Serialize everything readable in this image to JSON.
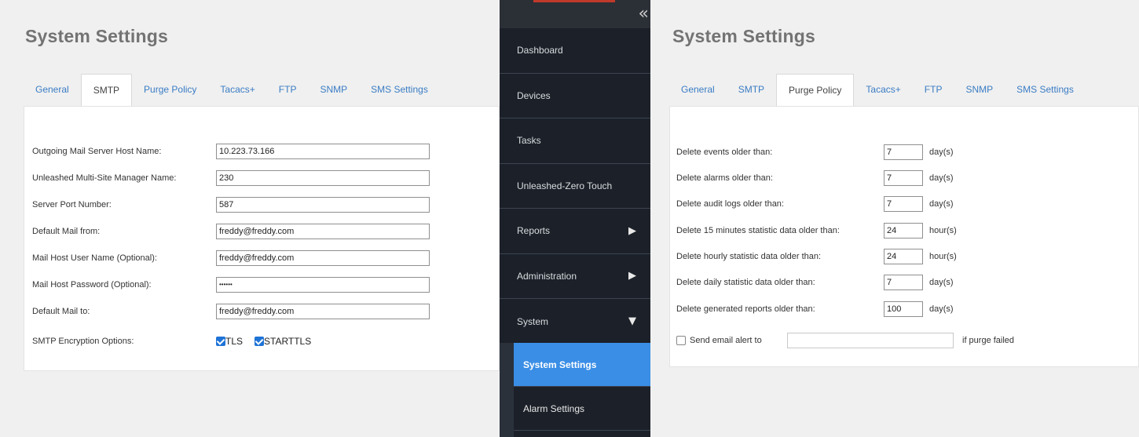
{
  "left_panel": {
    "title": "System Settings",
    "tabs": [
      {
        "label": "General"
      },
      {
        "label": "SMTP"
      },
      {
        "label": "Purge Policy"
      },
      {
        "label": "Tacacs+"
      },
      {
        "label": "FTP"
      },
      {
        "label": "SNMP"
      },
      {
        "label": "SMS Settings"
      }
    ],
    "active_tab": "SMTP",
    "fields": [
      {
        "label": "Outgoing Mail Server Host Name:",
        "value": "10.223.73.166"
      },
      {
        "label": "Unleashed Multi-Site Manager Name:",
        "value": "230"
      },
      {
        "label": "Server Port Number:",
        "value": "587"
      },
      {
        "label": "Default Mail from:",
        "value": "freddy@freddy.com"
      },
      {
        "label": "Mail Host User Name (Optional):",
        "value": "freddy@freddy.com"
      },
      {
        "label": "Mail Host Password (Optional):",
        "value": "••••••"
      },
      {
        "label": "Default Mail to:",
        "value": "freddy@freddy.com"
      }
    ],
    "encryption": {
      "label": "SMTP Encryption Options:",
      "options": [
        {
          "label": "TLS",
          "checked": true
        },
        {
          "label": "STARTTLS",
          "checked": true
        }
      ]
    }
  },
  "sidebar": {
    "items": [
      {
        "label": "Dashboard",
        "arrow": ""
      },
      {
        "label": "Devices",
        "arrow": ""
      },
      {
        "label": "Tasks",
        "arrow": ""
      },
      {
        "label": "Unleashed-Zero Touch",
        "arrow": ""
      },
      {
        "label": "Reports",
        "arrow": "▶"
      },
      {
        "label": "Administration",
        "arrow": "▶"
      },
      {
        "label": "System",
        "arrow": "▼"
      }
    ],
    "subitems": [
      {
        "label": "System Settings",
        "active": true
      },
      {
        "label": "Alarm Settings",
        "active": false
      }
    ],
    "collapse_glyph": "«"
  },
  "right_panel": {
    "title": "System Settings",
    "tabs": [
      {
        "label": "General"
      },
      {
        "label": "SMTP"
      },
      {
        "label": "Purge Policy"
      },
      {
        "label": "Tacacs+"
      },
      {
        "label": "FTP"
      },
      {
        "label": "SNMP"
      },
      {
        "label": "SMS Settings"
      }
    ],
    "active_tab": "Purge Policy",
    "rows": [
      {
        "label": "Delete events older than:",
        "value": "7",
        "unit": "day(s)"
      },
      {
        "label": "Delete alarms older than:",
        "value": "7",
        "unit": "day(s)"
      },
      {
        "label": "Delete audit logs older than:",
        "value": "7",
        "unit": "day(s)"
      },
      {
        "label": "Delete 15 minutes statistic data older than:",
        "value": "24",
        "unit": "hour(s)"
      },
      {
        "label": "Delete hourly statistic data older than:",
        "value": "24",
        "unit": "hour(s)"
      },
      {
        "label": "Delete daily statistic data older than:",
        "value": "7",
        "unit": "day(s)"
      },
      {
        "label": "Delete generated reports older than:",
        "value": "100",
        "unit": "day(s)"
      }
    ],
    "email_alert": {
      "label": "Send email alert to",
      "value": "",
      "suffix": "if purge failed",
      "checked": false
    }
  },
  "colors": {
    "accent_blue": "#3a8ee6",
    "tab_link": "#3a7cc4",
    "sidebar_bg": "#1c2129",
    "checkbox_blue": "#1f73d6"
  }
}
